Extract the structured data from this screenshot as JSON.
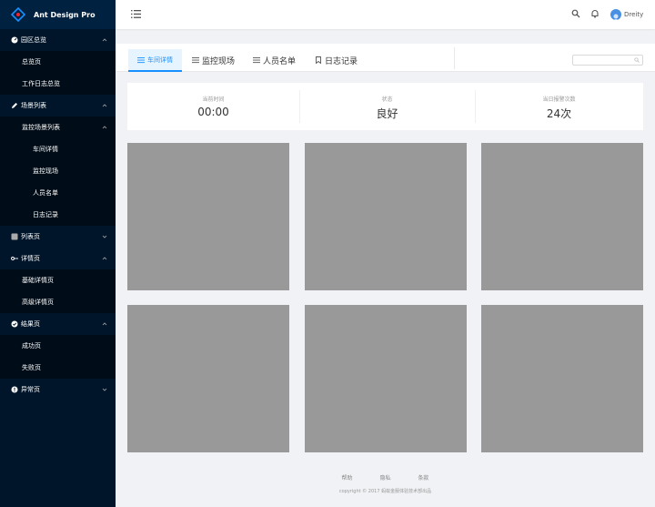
{
  "app": {
    "title": "Ant Design Pro"
  },
  "sidebar": {
    "items": [
      {
        "label": "园区总览",
        "icon": "dashboard-icon",
        "expanded": true
      },
      {
        "label": "总览页"
      },
      {
        "label": "工作日志总览"
      },
      {
        "label": "场景列表",
        "icon": "edit-icon",
        "expanded": true
      },
      {
        "label": "监控场景列表",
        "expanded": true
      },
      {
        "label": "车间详情"
      },
      {
        "label": "监控现场"
      },
      {
        "label": "人员名单"
      },
      {
        "label": "日志记录"
      },
      {
        "label": "列表页",
        "icon": "table-icon",
        "expanded": false
      },
      {
        "label": "详情页",
        "icon": "profile-icon",
        "expanded": true
      },
      {
        "label": "基础详情页"
      },
      {
        "label": "高级详情页"
      },
      {
        "label": "结果页",
        "icon": "check-circle-icon",
        "expanded": true
      },
      {
        "label": "成功页"
      },
      {
        "label": "失败页"
      },
      {
        "label": "异常页",
        "icon": "warning-icon",
        "expanded": false
      }
    ]
  },
  "header": {
    "username": "Dreity"
  },
  "tabs": [
    {
      "label": "车间详情",
      "icon": "menu-icon",
      "active": true
    },
    {
      "label": "监控现场",
      "icon": "menu-icon"
    },
    {
      "label": "人员名单",
      "icon": "menu-icon"
    },
    {
      "label": "日志记录",
      "icon": "bookmark-icon"
    }
  ],
  "stats": [
    {
      "label": "当前时间",
      "value": "00:00"
    },
    {
      "label": "状态",
      "value": "良好"
    },
    {
      "label": "当日报警次数",
      "value": "24次"
    }
  ],
  "footer": {
    "links": [
      "帮助",
      "隐私",
      "条款"
    ],
    "copyright": "copyright © 2017 蚂蚁金服体验技术部出品"
  },
  "colors": {
    "sidebar": "#001529",
    "accent": "#1890ff",
    "tile": "#999999"
  }
}
